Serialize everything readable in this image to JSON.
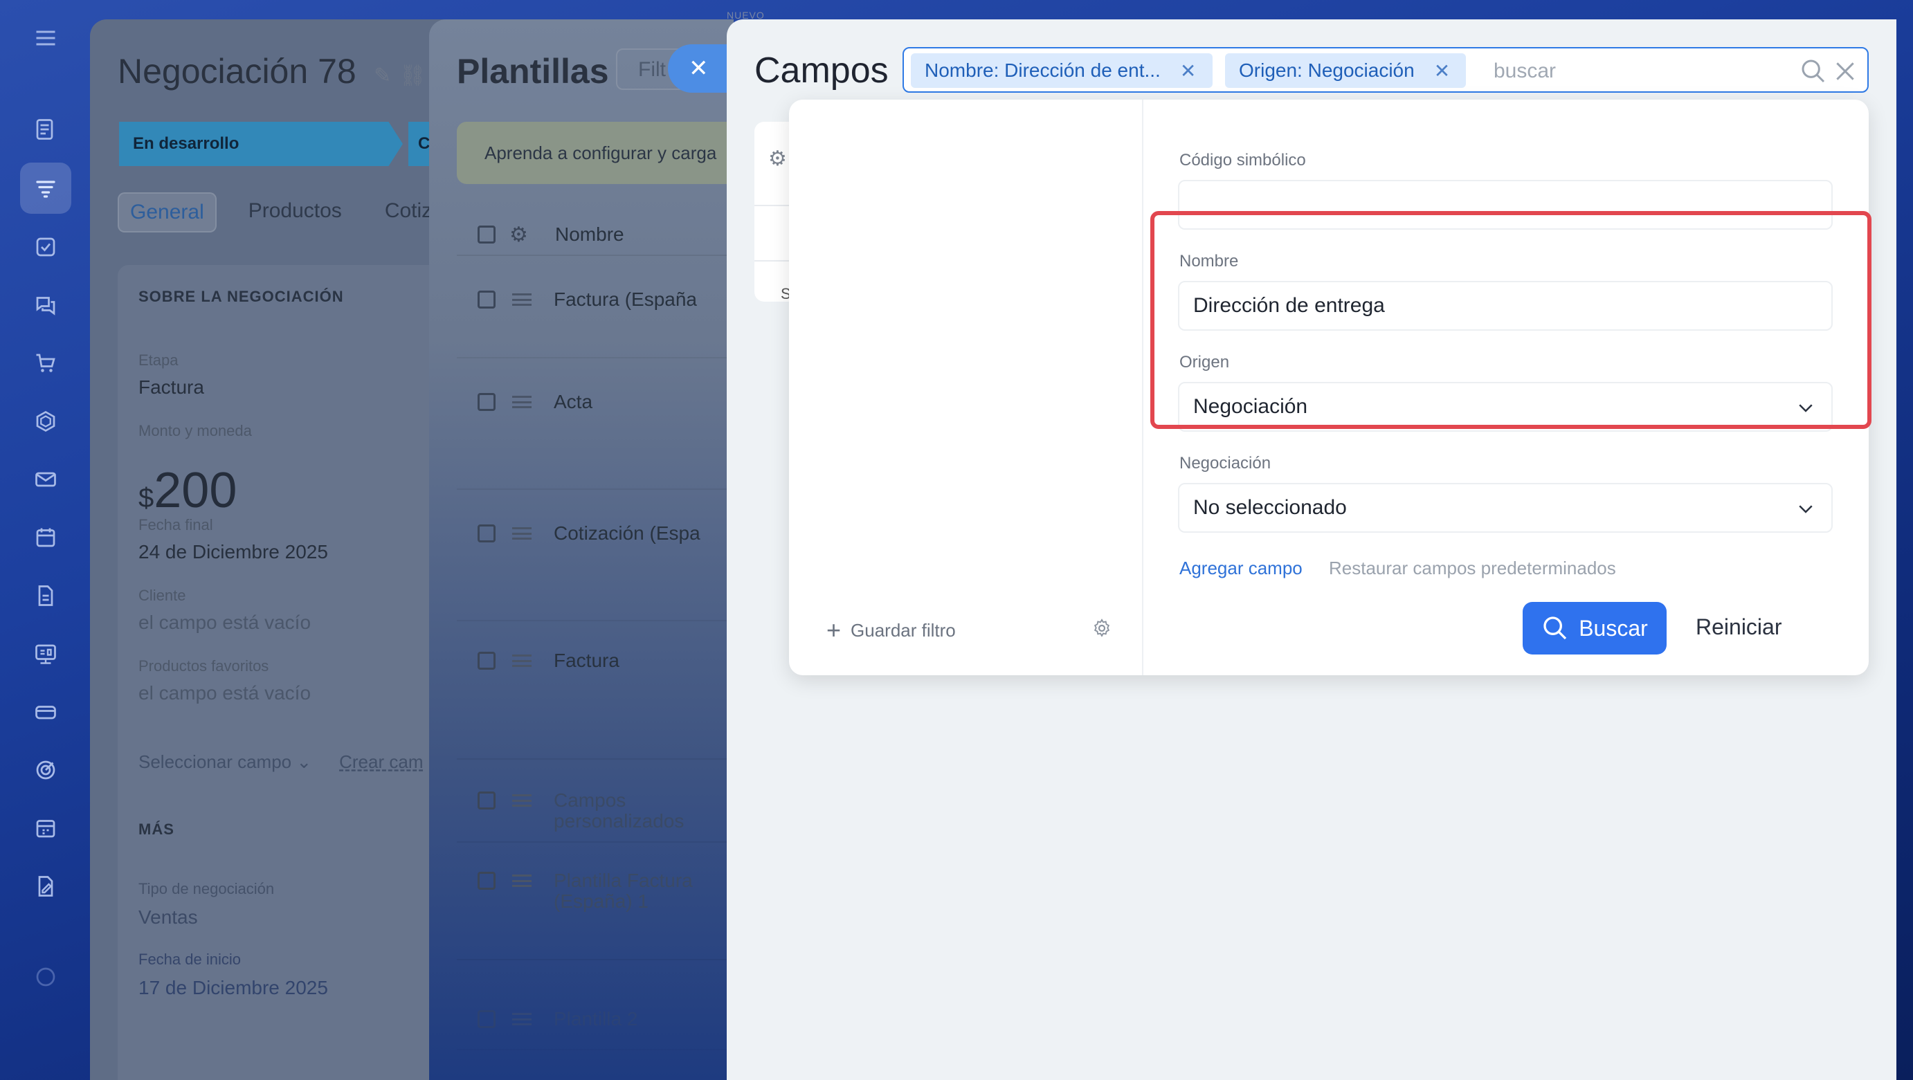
{
  "top_label": "NUEVO",
  "deal": {
    "title": "Negociación 78",
    "stage": "En desarrollo",
    "stage_next": "C",
    "tabs": [
      "General",
      "Productos",
      "Cotiza"
    ],
    "section_about": "SOBRE LA NEGOCIACIÓN",
    "etapa_label": "Etapa",
    "etapa_value": "Factura",
    "monto_label": "Monto y moneda",
    "monto_currency": "$",
    "monto_value": "200",
    "fecha_label": "Fecha final",
    "fecha_value": "24 de Diciembre 2025",
    "cliente_label": "Cliente",
    "cliente_value": "el campo está vacío",
    "productos_label": "Productos favoritos",
    "productos_value": "el campo está vacío",
    "select_field": "Seleccionar campo ⌄",
    "create_field": "Crear cam",
    "section_more": "MÁS",
    "tipo_label": "Tipo de negociación",
    "tipo_value": "Ventas",
    "fecha_inicio_label": "Fecha de inicio",
    "fecha_inicio_value": "17 de Diciembre 2025"
  },
  "templates": {
    "title": "Plantillas",
    "filter_placeholder": "Filt",
    "banner": "Aprenda a configurar y carga",
    "col_name": "Nombre",
    "rows": [
      {
        "name": "Factura (España"
      },
      {
        "name": "Acta"
      },
      {
        "name": "Cotización (Espa"
      },
      {
        "name": "Factura"
      },
      {
        "name": "Campos personalizados"
      },
      {
        "name": "Plantilla Factura (España) 1"
      },
      {
        "name": "Plantilla 2"
      }
    ]
  },
  "fields": {
    "title": "Campos",
    "chips": [
      {
        "label": "Nombre: Dirección de ent..."
      },
      {
        "label": "Origen: Negociación"
      }
    ],
    "search_placeholder": "buscar",
    "under_card_letter": "S",
    "popup": {
      "save_filter": "Guardar filtro",
      "codigo_label": "Código simbólico",
      "codigo_value": "",
      "nombre_label": "Nombre",
      "nombre_value": "Dirección de entrega",
      "origen_label": "Origen",
      "origen_value": "Negociación",
      "negociacion_label": "Negociación",
      "negociacion_value": "No seleccionado",
      "add_field": "Agregar campo",
      "restore_fields": "Restaurar campos predeterminados",
      "search_button": "Buscar",
      "reset_button": "Reiniciar"
    }
  },
  "colors": {
    "accent": "#2f72ee",
    "highlight": "#e2474f",
    "chip_bg": "#dbeafd"
  },
  "icons": {
    "rail": [
      "menu-icon",
      "feed-icon",
      "funnel-icon",
      "tasks-icon",
      "chat-icon",
      "cart-icon",
      "shield-icon",
      "mail-icon",
      "calendar-icon",
      "document-icon",
      "board-icon",
      "card-icon",
      "target-icon",
      "schedule-icon",
      "sign-icon",
      "help-icon"
    ]
  }
}
